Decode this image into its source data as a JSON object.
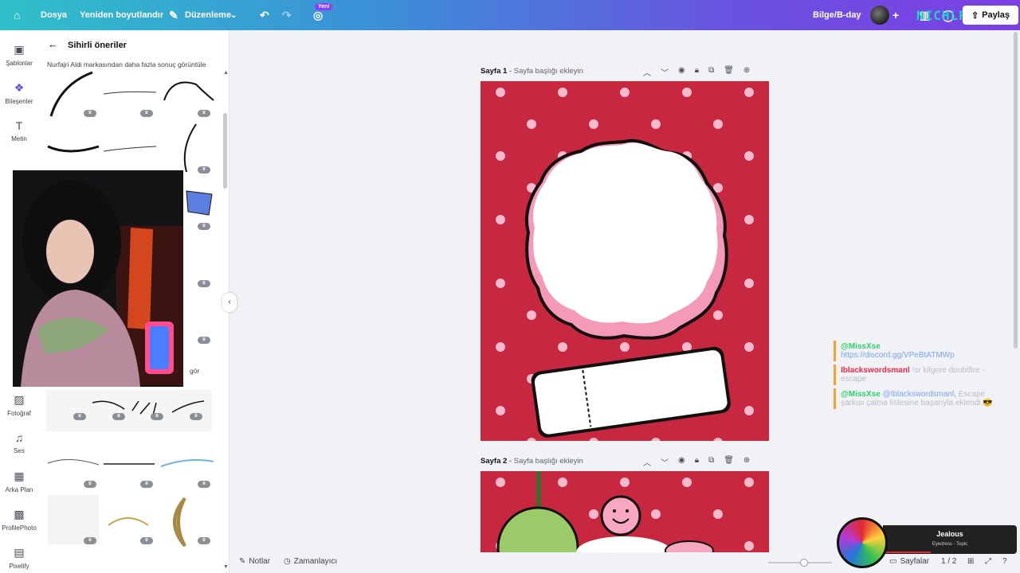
{
  "topbar": {
    "file": "Dosya",
    "resize": "Yeniden boyutlandır",
    "edit": "Düzenleme",
    "new_badge": "Yeni",
    "project": "Bilge/B-day",
    "share": "Paylaş",
    "watermark": "NICHLPH"
  },
  "rail": {
    "items": [
      {
        "label": "Şablonlar",
        "icon": "templates-icon"
      },
      {
        "label": "Bileşenler",
        "icon": "elements-icon"
      },
      {
        "label": "Metin",
        "icon": "text-icon"
      },
      {
        "label": "Fotoğraf",
        "icon": "photo-icon"
      },
      {
        "label": "Ses",
        "icon": "audio-icon"
      },
      {
        "label": "Arka Plan",
        "icon": "background-icon"
      },
      {
        "label": "ProfilePhoto",
        "icon": "profile-photo-icon"
      },
      {
        "label": "Pixelify",
        "icon": "pixelify-icon"
      }
    ]
  },
  "panel": {
    "title": "Sihirli öneriler",
    "subtitle": "Nurfajri Aldi markasından daha fazla sonuç görüntüle",
    "see_more": "gör"
  },
  "pages": [
    {
      "label": "Sayfa 1",
      "placeholder": "Sayfa başlığı ekleyin"
    },
    {
      "label": "Sayfa 2",
      "placeholder": "Sayfa başlığı ekleyin"
    }
  ],
  "bottombar": {
    "notes": "Notlar",
    "timer": "Zamanlayıcı",
    "pages": "Sayfalar",
    "page_count": "1 / 2"
  },
  "chat": [
    {
      "user": "@MissXse",
      "text": "https://discord.gg/VPeBtATMWp"
    },
    {
      "user": "Iblackswordsmanl",
      "text": "!sr kilgore doubtfire - escape"
    },
    {
      "user": "@MissXse",
      "mention": "@Iblackswordsmanl,",
      "text": "Escape şarkısı çalma listesine başarıyla eklendi 😎"
    }
  ],
  "music": {
    "title": "Jealous",
    "artist": "Eyedress - Topic"
  },
  "colors": {
    "page_bg": "#c8283f",
    "dots": "#f7b9cc",
    "accent": "#8b3dff"
  }
}
